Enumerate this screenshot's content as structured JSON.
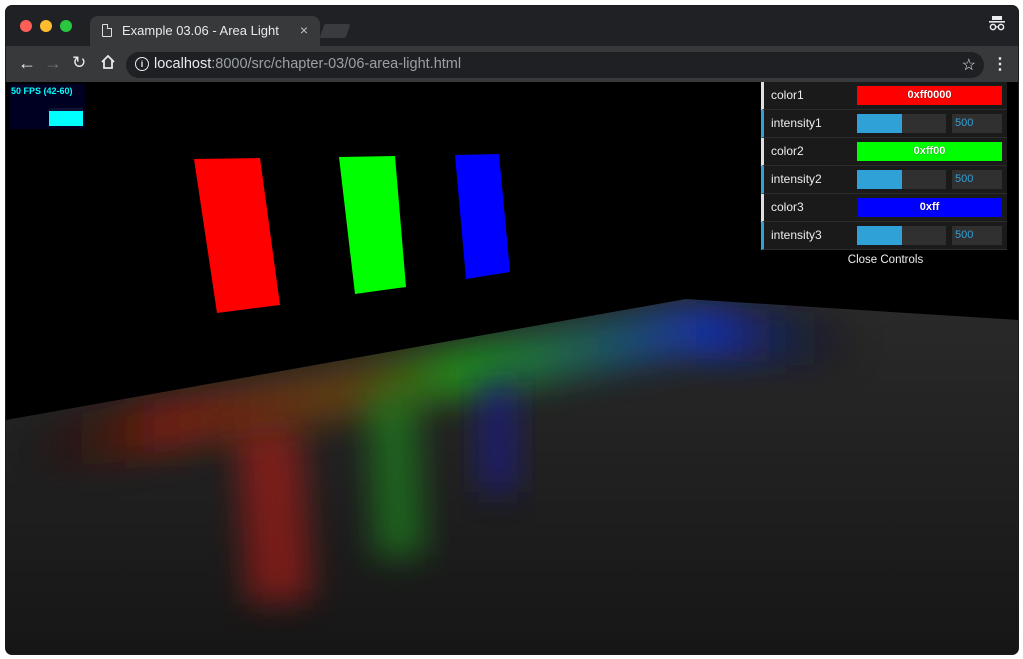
{
  "browser": {
    "tab_title": "Example 03.06 - Area Light",
    "tab_close_glyph": "×",
    "url_host": "localhost",
    "url_rest": ":8000/src/chapter-03/06-area-light.html"
  },
  "icons": {
    "back": "back-arrow-icon",
    "forward": "forward-arrow-icon",
    "reload": "reload-icon",
    "home": "home-icon",
    "info": "info-icon",
    "star": "star-icon",
    "menu": "kebab-menu-icon",
    "incognito": "incognito-icon",
    "page": "page-icon"
  },
  "stats": {
    "label": "50 FPS (42-60)"
  },
  "gui": {
    "rows": [
      {
        "label": "color1",
        "type": "color",
        "value": "0xff0000",
        "swatch": "#ff0000"
      },
      {
        "label": "intensity1",
        "type": "number",
        "value": "500",
        "fill_fraction": 0.5
      },
      {
        "label": "color2",
        "type": "color",
        "value": "0xff00",
        "swatch": "#00ff00"
      },
      {
        "label": "intensity2",
        "type": "number",
        "value": "500",
        "fill_fraction": 0.5
      },
      {
        "label": "color3",
        "type": "color",
        "value": "0xff",
        "swatch": "#0000ff"
      },
      {
        "label": "intensity3",
        "type": "number",
        "value": "500",
        "fill_fraction": 0.5
      }
    ],
    "close_label": "Close Controls"
  },
  "scene": {
    "lights": [
      {
        "name": "red",
        "color": "#ff0000"
      },
      {
        "name": "green",
        "color": "#00ff00"
      },
      {
        "name": "blue",
        "color": "#0000ff"
      }
    ]
  }
}
